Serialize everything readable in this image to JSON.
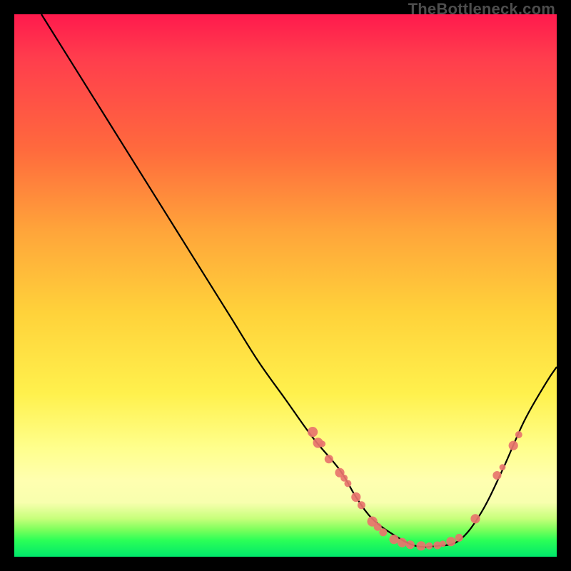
{
  "watermark": "TheBottleneck.com",
  "colors": {
    "curve": "#000000",
    "markers": "#e8746c",
    "bg_top": "#ff1a4d",
    "bg_bottom": "#00e76b"
  },
  "chart_data": {
    "type": "line",
    "title": "",
    "xlabel": "",
    "ylabel": "",
    "xlim": [
      0,
      100
    ],
    "ylim": [
      0,
      100
    ],
    "note": "No tick labels or axes are visible; values are estimated from pixel positions over a 0–100 normalized range, where y=0 is the bottom (green) and y=100 is the top (red).",
    "series": [
      {
        "name": "bottleneck-curve",
        "x": [
          5,
          10,
          15,
          20,
          25,
          30,
          35,
          40,
          45,
          50,
          55,
          60,
          63,
          66,
          70,
          74,
          78,
          82,
          86,
          90,
          94,
          98,
          100
        ],
        "y": [
          100,
          92,
          84,
          76,
          68,
          60,
          52,
          44,
          36,
          29,
          22,
          16,
          11,
          7,
          4,
          2,
          2,
          3,
          8,
          16,
          25,
          32,
          35
        ]
      }
    ],
    "markers": [
      {
        "x": 55,
        "y": 23,
        "r": 1.3
      },
      {
        "x": 56,
        "y": 21,
        "r": 1.3
      },
      {
        "x": 56.8,
        "y": 20.8,
        "r": 0.8
      },
      {
        "x": 58,
        "y": 18,
        "r": 1.1
      },
      {
        "x": 60,
        "y": 15.5,
        "r": 1.2
      },
      {
        "x": 60.8,
        "y": 14.5,
        "r": 0.9
      },
      {
        "x": 61.5,
        "y": 13.5,
        "r": 0.9
      },
      {
        "x": 63,
        "y": 11,
        "r": 1.2
      },
      {
        "x": 64,
        "y": 9.5,
        "r": 1.0
      },
      {
        "x": 66,
        "y": 6.5,
        "r": 1.3
      },
      {
        "x": 67,
        "y": 5.5,
        "r": 1.0
      },
      {
        "x": 68,
        "y": 4.5,
        "r": 1.0
      },
      {
        "x": 70,
        "y": 3.2,
        "r": 1.2
      },
      {
        "x": 71.5,
        "y": 2.6,
        "r": 1.2
      },
      {
        "x": 73,
        "y": 2.2,
        "r": 1.1
      },
      {
        "x": 75,
        "y": 2.0,
        "r": 1.2
      },
      {
        "x": 76.5,
        "y": 2.0,
        "r": 0.9
      },
      {
        "x": 78,
        "y": 2.1,
        "r": 1.0
      },
      {
        "x": 79,
        "y": 2.4,
        "r": 0.8
      },
      {
        "x": 80.5,
        "y": 2.8,
        "r": 1.2
      },
      {
        "x": 82,
        "y": 3.5,
        "r": 1.0
      },
      {
        "x": 85,
        "y": 7.0,
        "r": 1.2
      },
      {
        "x": 89,
        "y": 15.0,
        "r": 1.1
      },
      {
        "x": 90,
        "y": 16.5,
        "r": 0.8
      },
      {
        "x": 92,
        "y": 20.5,
        "r": 1.2
      },
      {
        "x": 93,
        "y": 22.5,
        "r": 0.9
      }
    ]
  }
}
